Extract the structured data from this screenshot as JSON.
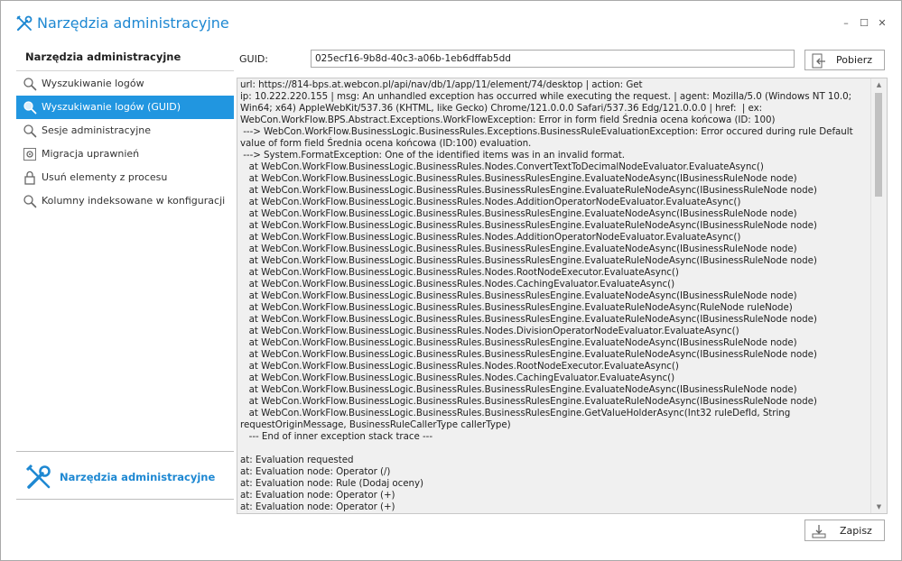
{
  "window": {
    "title": "Narzędzia administracyjne",
    "controls": {
      "minimize": "–",
      "maximize": "☐",
      "close": "✕"
    }
  },
  "sidebar": {
    "header": "Narzędzia administracyjne",
    "items": [
      {
        "label": "Wyszukiwanie logów",
        "icon": "magnifier-icon",
        "active": false
      },
      {
        "label": "Wyszukiwanie logów (GUID)",
        "icon": "magnifier-icon",
        "active": true
      },
      {
        "label": "Sesje administracyjne",
        "icon": "magnifier-icon",
        "active": false
      },
      {
        "label": "Migracja uprawnień",
        "icon": "gear-icon",
        "active": false
      },
      {
        "label": "Usuń elementy z procesu",
        "icon": "lock-icon",
        "active": false
      },
      {
        "label": "Kolumny indeksowane w konfiguracji",
        "icon": "magnifier-icon",
        "active": false
      }
    ],
    "footer": {
      "label": "Narzędzia administracyjne",
      "icon": "tools-icon"
    }
  },
  "guid": {
    "label": "GUID:",
    "value": "025ecf16-9b8d-40c3-a06b-1eb6dffab5dd"
  },
  "buttons": {
    "fetch": "Pobierz",
    "save": "Zapisz"
  },
  "log": {
    "text": "url: https://814-bps.at.webcon.pl/api/nav/db/1/app/11/element/74/desktop | action: Get\nip: 10.222.220.155 | msg: An unhandled exception has occurred while executing the request. | agent: Mozilla/5.0 (Windows NT 10.0; Win64; x64) AppleWebKit/537.36 (KHTML, like Gecko) Chrome/121.0.0.0 Safari/537.36 Edg/121.0.0.0 | href:  | ex: WebCon.WorkFlow.BPS.Abstract.Exceptions.WorkFlowException: Error in form field Średnia ocena końcowa (ID: 100)\n ---> WebCon.WorkFlow.BusinessLogic.BusinessRules.Exceptions.BusinessRuleEvaluationException: Error occured during rule Default value of form field Średnia ocena końcowa (ID:100) evaluation.\n ---> System.FormatException: One of the identified items was in an invalid format.\n   at WebCon.WorkFlow.BusinessLogic.BusinessRules.Nodes.ConvertTextToDecimalNodeEvaluator.EvaluateAsync()\n   at WebCon.WorkFlow.BusinessLogic.BusinessRules.BusinessRulesEngine.EvaluateNodeAsync(IBusinessRuleNode node)\n   at WebCon.WorkFlow.BusinessLogic.BusinessRules.BusinessRulesEngine.EvaluateRuleNodeAsync(IBusinessRuleNode node)\n   at WebCon.WorkFlow.BusinessLogic.BusinessRules.Nodes.AdditionOperatorNodeEvaluator.EvaluateAsync()\n   at WebCon.WorkFlow.BusinessLogic.BusinessRules.BusinessRulesEngine.EvaluateNodeAsync(IBusinessRuleNode node)\n   at WebCon.WorkFlow.BusinessLogic.BusinessRules.BusinessRulesEngine.EvaluateRuleNodeAsync(IBusinessRuleNode node)\n   at WebCon.WorkFlow.BusinessLogic.BusinessRules.Nodes.AdditionOperatorNodeEvaluator.EvaluateAsync()\n   at WebCon.WorkFlow.BusinessLogic.BusinessRules.BusinessRulesEngine.EvaluateNodeAsync(IBusinessRuleNode node)\n   at WebCon.WorkFlow.BusinessLogic.BusinessRules.BusinessRulesEngine.EvaluateRuleNodeAsync(IBusinessRuleNode node)\n   at WebCon.WorkFlow.BusinessLogic.BusinessRules.Nodes.RootNodeExecutor.EvaluateAsync()\n   at WebCon.WorkFlow.BusinessLogic.BusinessRules.Nodes.CachingEvaluator.EvaluateAsync()\n   at WebCon.WorkFlow.BusinessLogic.BusinessRules.BusinessRulesEngine.EvaluateNodeAsync(IBusinessRuleNode node)\n   at WebCon.WorkFlow.BusinessLogic.BusinessRules.BusinessRulesEngine.EvaluateRuleNodeAsync(RuleNode ruleNode)\n   at WebCon.WorkFlow.BusinessLogic.BusinessRules.BusinessRulesEngine.EvaluateRuleNodeAsync(IBusinessRuleNode node)\n   at WebCon.WorkFlow.BusinessLogic.BusinessRules.Nodes.DivisionOperatorNodeEvaluator.EvaluateAsync()\n   at WebCon.WorkFlow.BusinessLogic.BusinessRules.BusinessRulesEngine.EvaluateNodeAsync(IBusinessRuleNode node)\n   at WebCon.WorkFlow.BusinessLogic.BusinessRules.BusinessRulesEngine.EvaluateRuleNodeAsync(IBusinessRuleNode node)\n   at WebCon.WorkFlow.BusinessLogic.BusinessRules.Nodes.RootNodeExecutor.EvaluateAsync()\n   at WebCon.WorkFlow.BusinessLogic.BusinessRules.Nodes.CachingEvaluator.EvaluateAsync()\n   at WebCon.WorkFlow.BusinessLogic.BusinessRules.BusinessRulesEngine.EvaluateNodeAsync(IBusinessRuleNode node)\n   at WebCon.WorkFlow.BusinessLogic.BusinessRules.BusinessRulesEngine.EvaluateRuleNodeAsync(IBusinessRuleNode node)\n   at WebCon.WorkFlow.BusinessLogic.BusinessRules.BusinessRulesEngine.GetValueHolderAsync(Int32 ruleDefId, String requestOriginMessage, BusinessRuleCallerType callerType)\n   --- End of inner exception stack trace ---\n\nat: Evaluation requested\nat: Evaluation node: Operator (/)\nat: Evaluation node: Rule (Dodaj oceny)\nat: Evaluation node: Operator (+)\nat: Evaluation node: Operator (+)"
  }
}
